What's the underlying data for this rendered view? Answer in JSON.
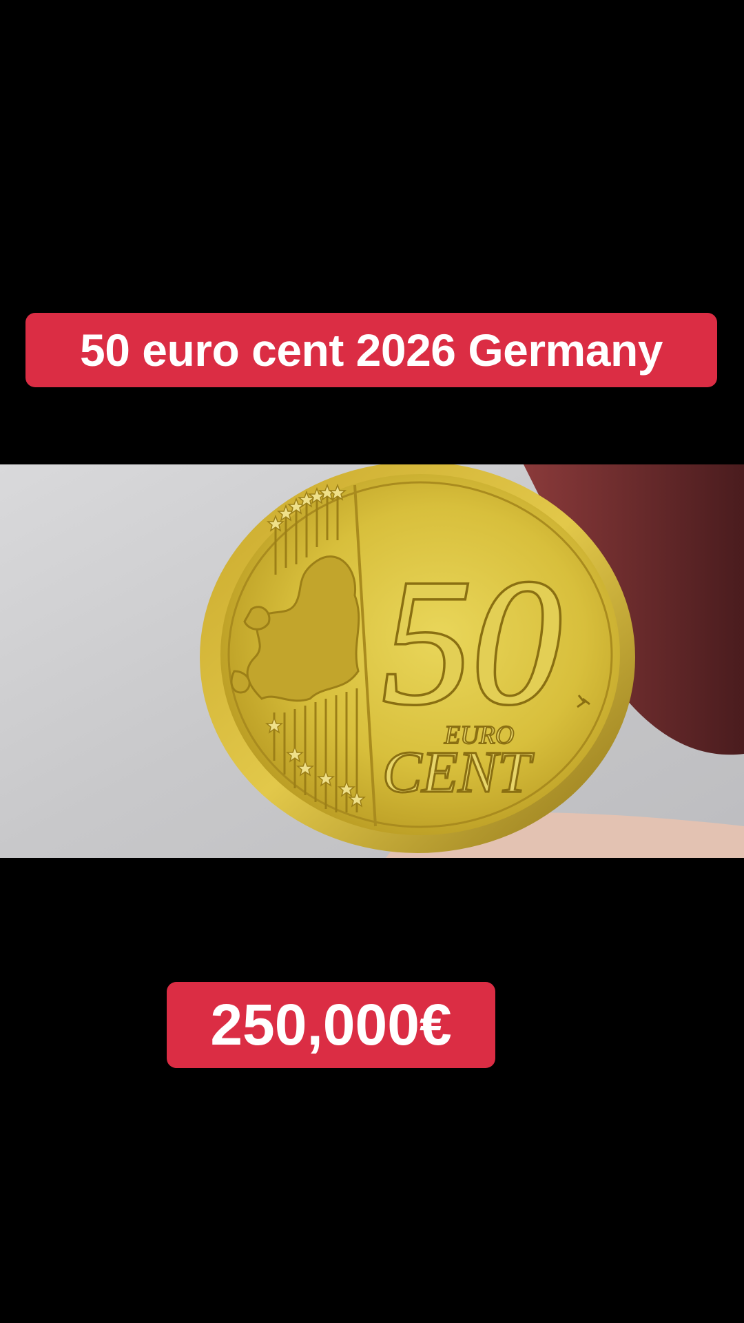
{
  "overlay": {
    "title": "50 euro cent 2026 Germany",
    "price": "250,000€"
  },
  "coin": {
    "denomination": "50",
    "word_euro": "EURO",
    "word_cent": "CENT"
  },
  "colors": {
    "caption_background": "#db2d44",
    "caption_text": "#ffffff",
    "background": "#000000",
    "coin_gold": "#d8bf3c"
  },
  "icons": [
    "star-icon",
    "europe-map-icon",
    "mint-mark-icon"
  ]
}
